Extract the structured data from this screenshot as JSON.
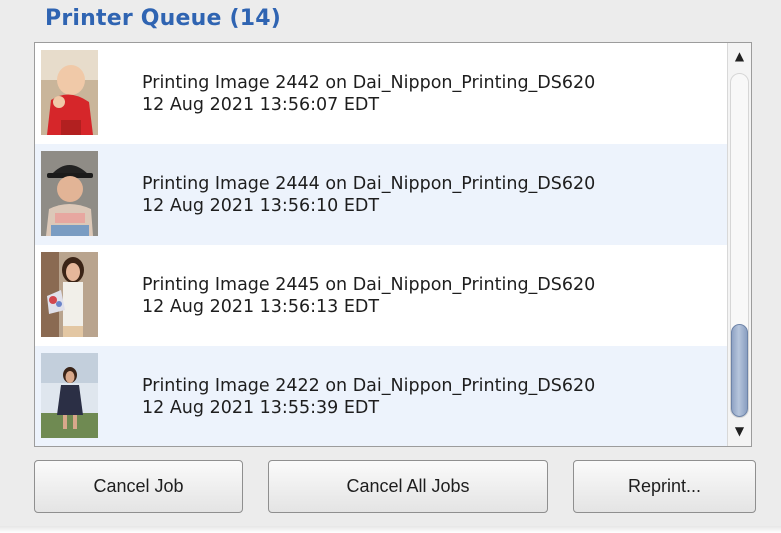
{
  "panel": {
    "title": "Printer Queue (14)"
  },
  "queue": [
    {
      "line1": "Printing Image 2442 on Dai_Nippon_Printing_DS620",
      "line2": "12 Aug 2021 13:56:07 EDT"
    },
    {
      "line1": "Printing Image 2444 on Dai_Nippon_Printing_DS620",
      "line2": "12 Aug 2021 13:56:10 EDT"
    },
    {
      "line1": "Printing Image 2445 on Dai_Nippon_Printing_DS620",
      "line2": "12 Aug 2021 13:56:13 EDT"
    },
    {
      "line1": "Printing Image 2422 on Dai_Nippon_Printing_DS620",
      "line2": "12 Aug 2021 13:55:39 EDT"
    }
  ],
  "buttons": {
    "cancel_job": "Cancel Job",
    "cancel_all": "Cancel All Jobs",
    "reprint": "Reprint..."
  },
  "scrollbar": {
    "up_glyph": "▲",
    "down_glyph": "▼"
  },
  "colors": {
    "title": "#2f64b2",
    "alt_row": "#edf3fc"
  },
  "icons": [
    "photo-thumbnail",
    "scroll-up-arrow",
    "scroll-down-arrow"
  ]
}
